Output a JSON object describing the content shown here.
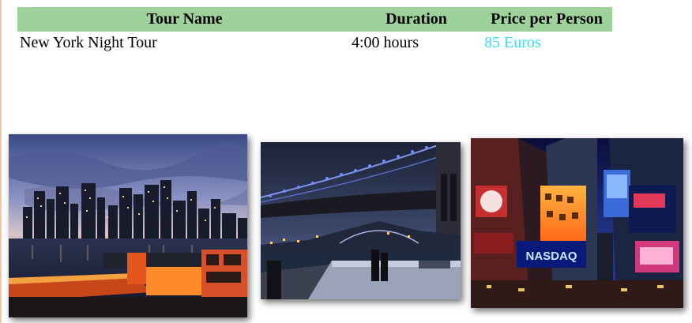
{
  "table": {
    "headers": {
      "name": "Tour Name",
      "duration": "Duration",
      "price": "Price per Person"
    },
    "rows": [
      {
        "name": "New York Night Tour",
        "duration": "4:00 hours",
        "price": "85 Euros"
      }
    ]
  },
  "photos": [
    {
      "subject": "Manhattan skyline at dusk"
    },
    {
      "subject": "Brooklyn Bridge at night"
    },
    {
      "subject": "Times Square at night"
    }
  ],
  "sign_text": {
    "nasdaq": "NASDAQ"
  },
  "colors": {
    "header_bg": "#9dd39a",
    "price_text": "#35e0f0",
    "left_edge": "#f6c9a6"
  }
}
